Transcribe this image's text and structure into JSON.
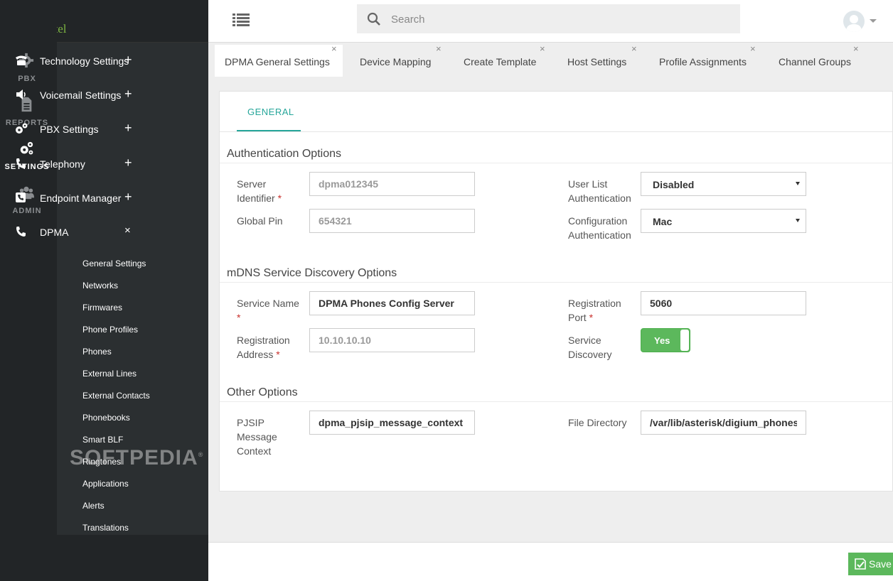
{
  "brand": {
    "name": "Ombutel"
  },
  "rail": [
    {
      "label": "PBX",
      "icon": "gear-icon"
    },
    {
      "label": "REPORTS",
      "icon": "document-icon"
    },
    {
      "label": "SETTINGS",
      "icon": "gears-icon",
      "active": true
    },
    {
      "label": "ADMIN",
      "icon": "users-icon"
    }
  ],
  "nav": {
    "items": [
      {
        "label": "Technology Settings",
        "toggle": "+",
        "icon": "phone-icon"
      },
      {
        "label": "Voicemail Settings",
        "toggle": "+",
        "icon": "speaker-icon"
      },
      {
        "label": "PBX Settings",
        "toggle": "+",
        "icon": "gears-icon"
      },
      {
        "label": "Telephony",
        "toggle": "+",
        "icon": "handset-icon"
      },
      {
        "label": "Endpoint Manager",
        "toggle": "+",
        "icon": "phone-square-icon"
      },
      {
        "label": "DPMA",
        "toggle": "×",
        "icon": "handset-icon"
      }
    ],
    "subitems": [
      "General Settings",
      "Networks",
      "Firmwares",
      "Phone Profiles",
      "Phones",
      "External Lines",
      "External Contacts",
      "Phonebooks",
      "Smart BLF",
      "Ringtones",
      "Applications",
      "Alerts",
      "Translations"
    ]
  },
  "watermark": "SOFTPEDIA",
  "search": {
    "placeholder": "Search"
  },
  "tabs": [
    "DPMA General Settings",
    "Device Mapping",
    "Create Template",
    "Host Settings",
    "Profile Assignments",
    "Channel Groups"
  ],
  "subtab": "GENERAL",
  "sections": {
    "auth": {
      "title": "Authentication Options",
      "server_identifier_label": "Server Identifier",
      "server_identifier_value": "dpma012345",
      "global_pin_label": "Global Pin",
      "global_pin_value": "654321",
      "user_list_label": "User List Authentication",
      "user_list_value": "Disabled",
      "config_auth_label": "Configuration Authentication",
      "config_auth_value": "Mac"
    },
    "mdns": {
      "title": "mDNS Service Discovery Options",
      "service_name_label": "Service Name",
      "service_name_value": "DPMA Phones Config Server",
      "reg_address_label": "Registration Address",
      "reg_address_value": "10.10.10.10",
      "reg_port_label": "Registration Port",
      "reg_port_value": "5060",
      "discovery_label": "Service Discovery",
      "discovery_value": "Yes"
    },
    "other": {
      "title": "Other Options",
      "pjsip_label": "PJSIP Message Context",
      "pjsip_value": "dpma_pjsip_message_context",
      "file_dir_label": "File Directory",
      "file_dir_value": "/var/lib/asterisk/digium_phones"
    }
  },
  "required_marker": "*",
  "tab_close": "×",
  "save_label": "Save",
  "colors": {
    "accent": "#26a69a",
    "success": "#5cb85c",
    "sidebar": "#222527"
  }
}
